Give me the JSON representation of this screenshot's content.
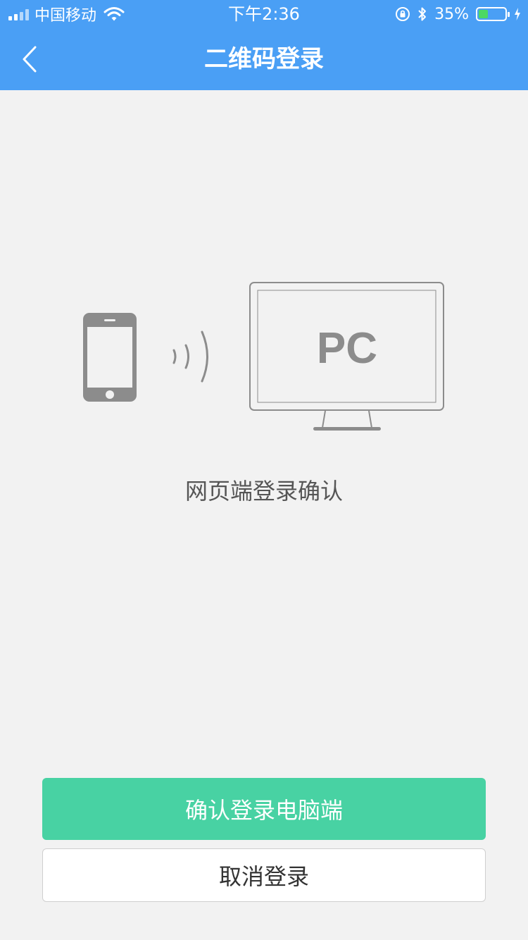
{
  "status_bar": {
    "carrier": "中国移动",
    "time": "下午2:36",
    "battery_percent": "35%",
    "battery_level": 0.35,
    "icons": [
      "signal-icon",
      "wifi-icon",
      "orientation-lock-icon",
      "bluetooth-icon",
      "battery-icon",
      "charging-icon"
    ]
  },
  "nav": {
    "title": "二维码登录",
    "back_icon": "chevron-left-icon"
  },
  "illustration": {
    "pc_label": "PC",
    "icons": [
      "phone-icon",
      "signal-waves-icon",
      "monitor-icon"
    ]
  },
  "main": {
    "confirm_text": "网页端登录确认"
  },
  "buttons": {
    "confirm_label": "确认登录电脑端",
    "cancel_label": "取消登录"
  },
  "colors": {
    "header": "#4a9ff5",
    "confirm_button": "#48d2a3",
    "background": "#f2f2f2",
    "illustration_gray": "#8c8c8c",
    "battery_green": "#4cd964"
  }
}
